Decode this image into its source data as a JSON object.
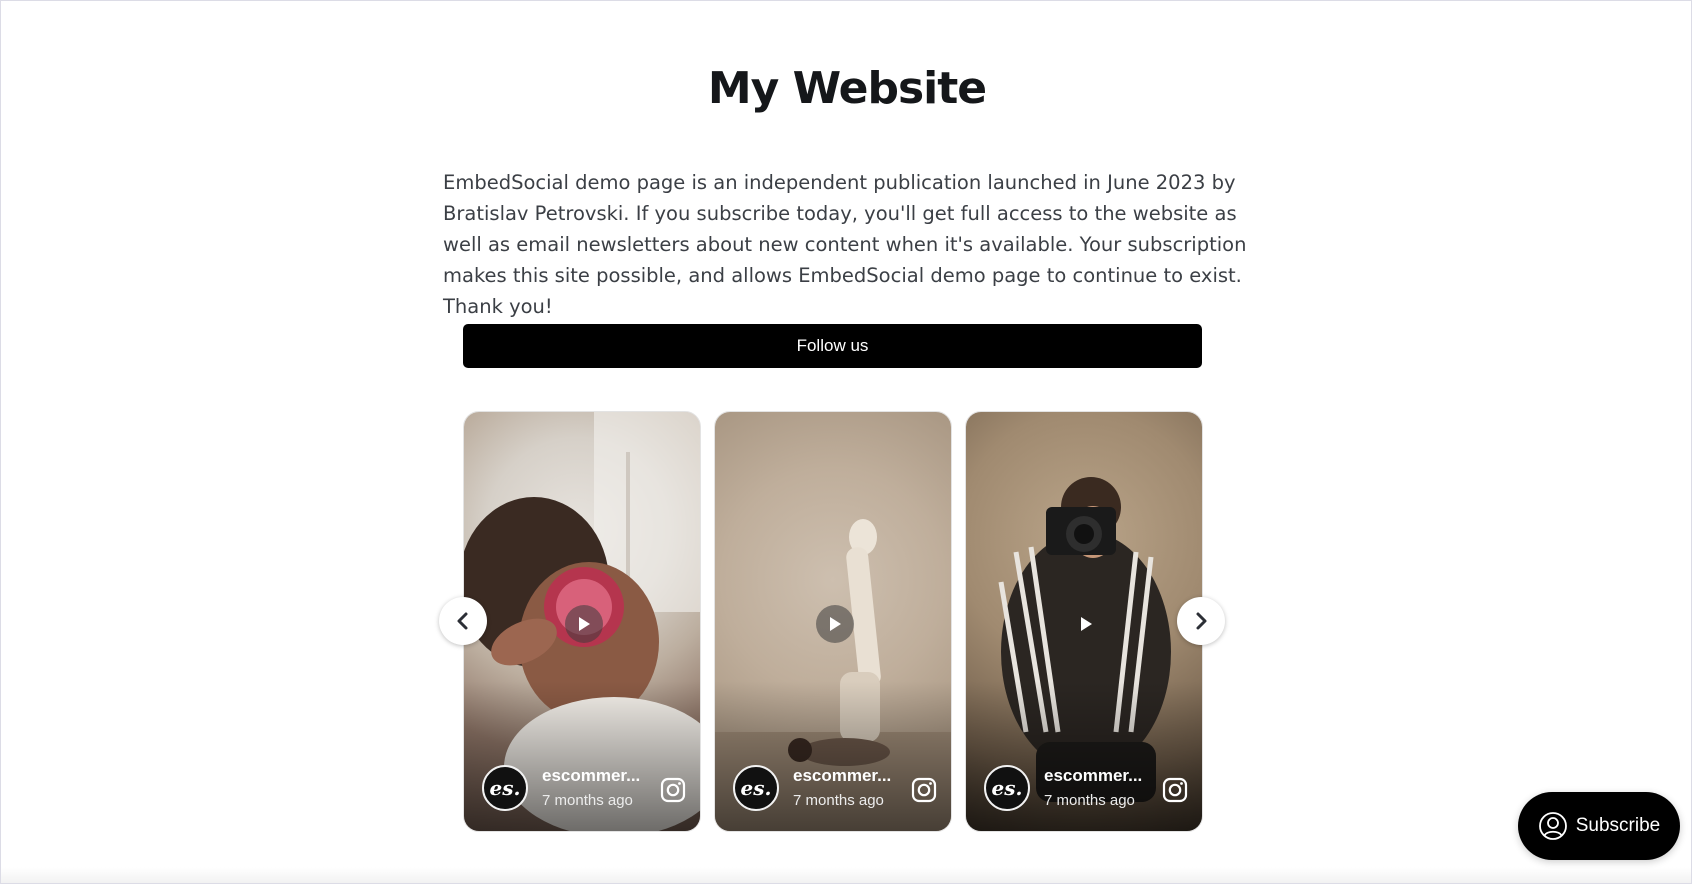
{
  "page": {
    "title": "My Website",
    "description": "EmbedSocial demo page is an independent publication launched in June 2023 by Bratislav Petrovski. If you subscribe today, you'll get full access to the website as well as email newsletters about new content when it's available. Your subscription makes this site possible, and allows EmbedSocial demo page to continue to exist. Thank you!"
  },
  "follow_button": {
    "label": "Follow us"
  },
  "carousel": {
    "cards": [
      {
        "avatar_text": "es.",
        "username": "escommer...",
        "time": "7 months ago",
        "icon": "instagram-icon"
      },
      {
        "avatar_text": "es.",
        "username": "escommer...",
        "time": "7 months ago",
        "icon": "instagram-icon"
      },
      {
        "avatar_text": "es.",
        "username": "escommer...",
        "time": "7 months ago",
        "icon": "instagram-icon"
      }
    ],
    "prev_icon": "chevron-left-icon",
    "next_icon": "chevron-right-icon"
  },
  "subscribe_button": {
    "label": "Subscribe",
    "icon": "user-circle-icon"
  },
  "colors": {
    "text": "#15171a",
    "button_bg": "#000000",
    "button_text": "#ffffff"
  }
}
